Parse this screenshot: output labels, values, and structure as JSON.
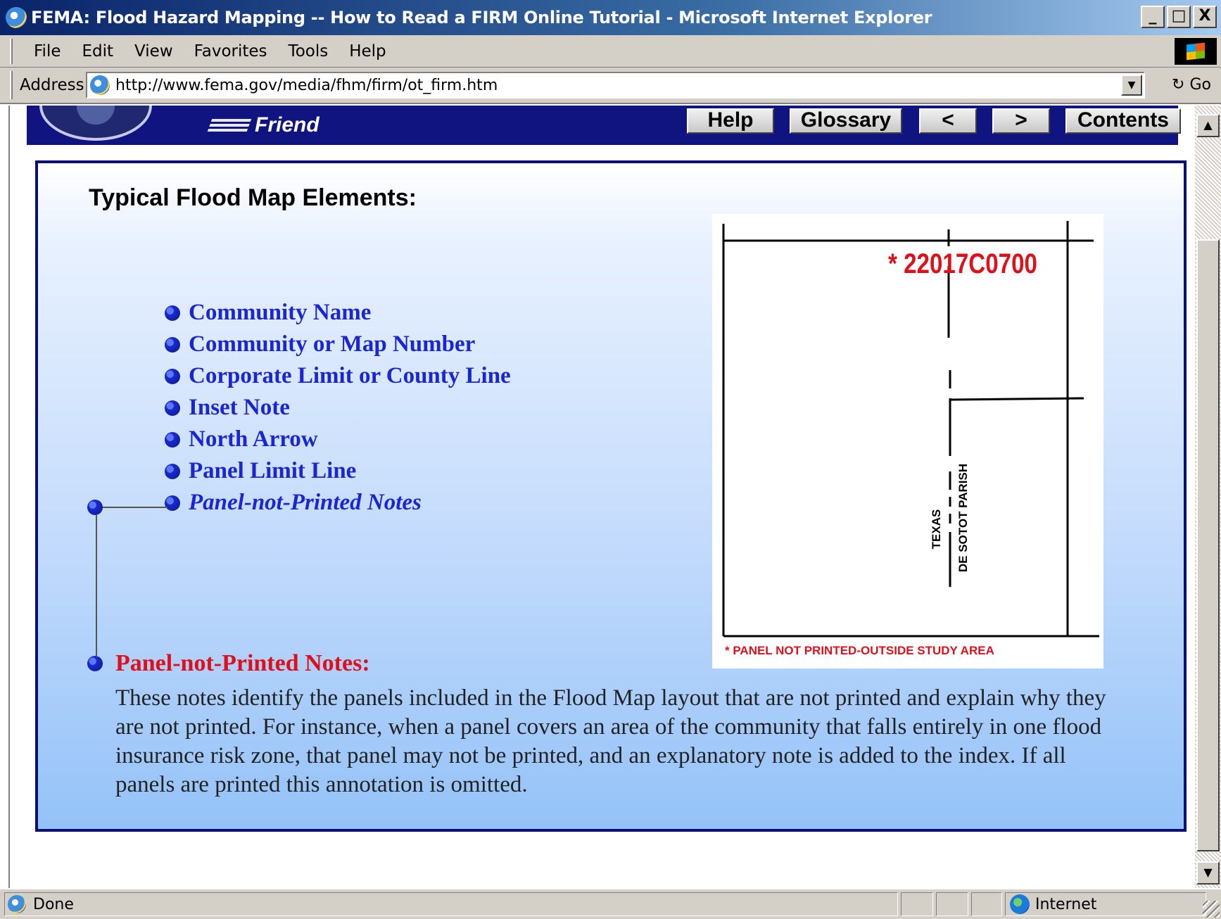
{
  "window": {
    "title": "FEMA: Flood Hazard Mapping -- How to Read a FIRM Online Tutorial - Microsoft Internet Explorer",
    "minimize_label": "_",
    "maximize_label": "□",
    "close_label": "X"
  },
  "menu": {
    "items": [
      "File",
      "Edit",
      "View",
      "Favorites",
      "Tools",
      "Help"
    ]
  },
  "address": {
    "label": "Address",
    "url": "http://www.fema.gov/media/fhm/firm/ot_firm.htm",
    "go_label": "Go",
    "dropdown_glyph": "▼"
  },
  "page": {
    "header": {
      "tell_friend": "Friend",
      "nav": {
        "help": "Help",
        "glossary": "Glossary",
        "prev": "<",
        "next": ">",
        "contents": "Contents"
      }
    },
    "heading": "Typical Flood Map Elements:",
    "elements": [
      "Community Name",
      "Community or Map Number",
      "Corporate Limit or County Line",
      "Inset Note",
      "North Arrow",
      "Panel Limit Line",
      "Panel-not-Printed Notes"
    ],
    "detail": {
      "title": "Panel-not-Printed Notes:",
      "body": "These notes identify the panels included in the Flood Map layout that are not printed and explain why they are not printed. For instance, when a panel covers an area of the community that falls entirely in one flood insurance risk zone, that panel may not be printed, and an explanatory note is added to the index. If all panels are printed this annotation is omitted."
    },
    "map": {
      "panel_code": "* 22017C0700",
      "label_left": "TEXAS",
      "label_right": "DE SOTOT PARISH",
      "footnote": "* PANEL NOT PRINTED-OUTSIDE STUDY AREA"
    }
  },
  "scrollbar": {
    "up_glyph": "▲",
    "down_glyph": "▼"
  },
  "status": {
    "text": "Done",
    "zone": "Internet"
  }
}
